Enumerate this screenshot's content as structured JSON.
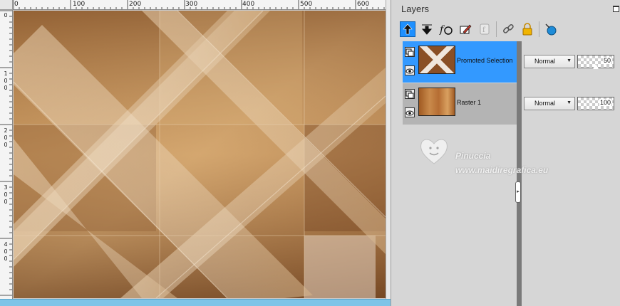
{
  "canvas": {
    "ruler_h_labels": [
      "0",
      "100",
      "200",
      "300",
      "400",
      "500",
      "600"
    ],
    "ruler_v_labels": [
      [
        "0"
      ],
      [
        "1",
        "0",
        "0"
      ],
      [
        "2",
        "0",
        "0"
      ],
      [
        "3",
        "0",
        "0"
      ],
      [
        "4",
        "0",
        "0"
      ]
    ]
  },
  "layers_panel": {
    "title": "Layers",
    "toolbar_icons": [
      "move-layer-up-icon",
      "move-layer-down-icon",
      "layer-styles-icon",
      "edit-selection-icon",
      "mask-icon",
      "link-icon",
      "lock-icon",
      "new-layer-icon"
    ],
    "layers": [
      {
        "name": "Promoted Selection",
        "blend": "Normal",
        "opacity": "50",
        "selected": true
      },
      {
        "name": "Raster 1",
        "blend": "Normal",
        "opacity": "100",
        "selected": false
      }
    ]
  },
  "watermark": {
    "name": "Pinuccia",
    "url": "www.maidiregrafica.eu"
  },
  "colors": {
    "selection": "#3399ff",
    "active_tool": "#1e90ff",
    "scrollbar": "#7fc4e8"
  }
}
